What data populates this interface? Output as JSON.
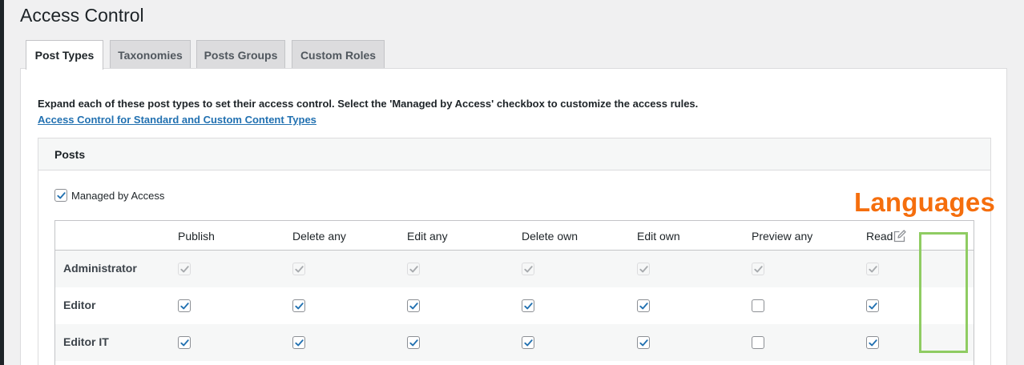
{
  "page": {
    "title": "Access Control"
  },
  "tabs": [
    {
      "label": "Post Types",
      "active": true
    },
    {
      "label": "Taxonomies",
      "active": false
    },
    {
      "label": "Posts Groups",
      "active": false
    },
    {
      "label": "Custom Roles",
      "active": false
    }
  ],
  "intro": {
    "text": "Expand each of these post types to set their access control. Select the 'Managed by Access' checkbox to customize the access rules.",
    "link_label": "Access Control for Standard and Custom Content Types"
  },
  "box": {
    "title": "Posts",
    "managed_label": "Managed by Access",
    "managed_checked": true
  },
  "table": {
    "columns": [
      "Publish",
      "Delete any",
      "Edit any",
      "Delete own",
      "Edit own",
      "Preview any",
      "Read"
    ],
    "rows": [
      {
        "label": "Administrator",
        "disabled": true,
        "values": [
          true,
          true,
          true,
          true,
          true,
          true,
          true
        ]
      },
      {
        "label": "Editor",
        "disabled": false,
        "values": [
          true,
          true,
          true,
          true,
          true,
          false,
          true
        ]
      },
      {
        "label": "Editor IT",
        "disabled": false,
        "values": [
          true,
          true,
          true,
          true,
          true,
          false,
          true
        ]
      }
    ]
  },
  "annotation": {
    "label": "Languages",
    "color": "#f56e0d",
    "box_color": "#8fcc62"
  },
  "icons": {
    "edit_column": "edit-icon"
  }
}
